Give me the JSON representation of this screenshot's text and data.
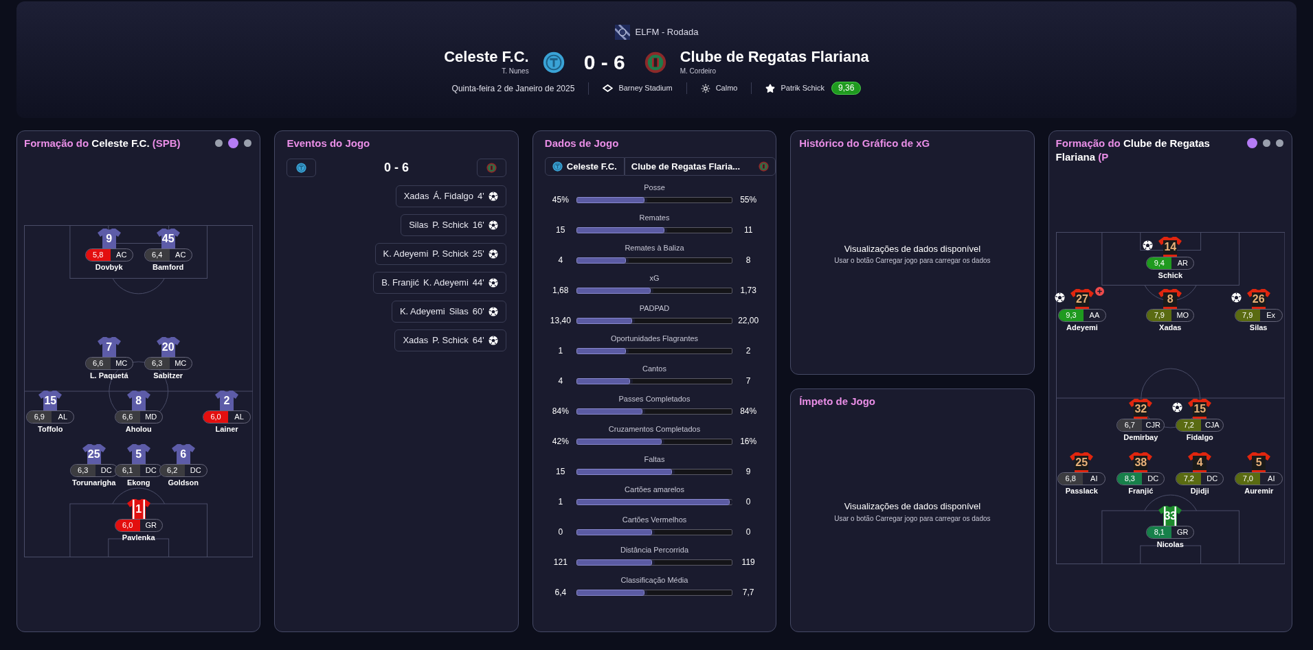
{
  "header": {
    "competition": "ELFM - Rodada",
    "home": {
      "name": "Celeste F.C.",
      "manager": "T. Nunes"
    },
    "score": "0 - 6",
    "away": {
      "name": "Clube de Regatas Flariana",
      "manager": "M. Cordeiro"
    },
    "date": "Quinta-feira 2 de Janeiro de 2025",
    "stadium": "Barney Stadium",
    "weather": "Calmo",
    "player_of_match": {
      "name": "Patrik Schick",
      "rating": "9,36",
      "color": "#1f9a1f"
    }
  },
  "home_lineup": {
    "title_prefix": "Formação do",
    "team": "Celeste F.C.",
    "suffix": "(SPB)",
    "dots": [
      {
        "selected": false
      },
      {
        "selected": true
      },
      {
        "selected": false
      }
    ],
    "rows": [
      {
        "kind": "compact",
        "players": [
          {
            "number": "9",
            "rating": "5,8",
            "color": "#e30f0f",
            "position": "AC",
            "name": "Dovbyk",
            "kind": "purple",
            "goal": false,
            "plus": false
          },
          {
            "number": "45",
            "rating": "6,4",
            "color": "#3c3c40",
            "position": "AC",
            "name": "Bamford",
            "kind": "purple",
            "goal": false,
            "plus": false
          }
        ]
      },
      {
        "kind": "compact",
        "players": [
          {
            "number": "7",
            "rating": "6,6",
            "color": "#3c3c40",
            "position": "MC",
            "name": "L. Paquetá",
            "kind": "purple",
            "goal": false,
            "plus": false
          },
          {
            "number": "20",
            "rating": "6,3",
            "color": "#3c3c40",
            "position": "MC",
            "name": "Sabitzer",
            "kind": "purple",
            "goal": false,
            "plus": false
          }
        ]
      },
      {
        "kind": "wide",
        "players": [
          {
            "number": "15",
            "rating": "6,9",
            "color": "#3c3c40",
            "position": "AL",
            "name": "Toffolo",
            "kind": "purple",
            "goal": false,
            "plus": false
          },
          {
            "number": "8",
            "rating": "6,6",
            "color": "#3c3c40",
            "position": "MD",
            "name": "Aholou",
            "kind": "purple",
            "goal": false,
            "plus": false
          },
          {
            "number": "2",
            "rating": "6,0",
            "color": "#e30f0f",
            "position": "AL",
            "name": "Lainer",
            "kind": "purple",
            "goal": false,
            "plus": false
          }
        ]
      },
      {
        "kind": "compact",
        "players": [
          {
            "number": "25",
            "rating": "6,3",
            "color": "#3c3c40",
            "position": "DC",
            "name": "Torunarigha",
            "kind": "purple",
            "goal": false,
            "plus": false
          },
          {
            "number": "5",
            "rating": "6,1",
            "color": "#3c3c40",
            "position": "DC",
            "name": "Ekong",
            "kind": "purple",
            "goal": false,
            "plus": false
          },
          {
            "number": "6",
            "rating": "6,2",
            "color": "#3c3c40",
            "position": "DC",
            "name": "Goldson",
            "kind": "purple",
            "goal": false,
            "plus": false
          }
        ]
      },
      {
        "kind": "compact",
        "players": [
          {
            "number": "1",
            "rating": "6,0",
            "color": "#e30f0f",
            "position": "GR",
            "name": "Pavlenka",
            "kind": "red-white",
            "goal": false,
            "plus": false
          }
        ]
      }
    ]
  },
  "events": {
    "title": "Eventos do Jogo",
    "score": "0 - 6",
    "items": [
      {
        "kind": "away",
        "assist": "Xadas",
        "scorer": "Á. Fidalgo",
        "minute": "4'"
      },
      {
        "kind": "away",
        "assist": "Silas",
        "scorer": "P. Schick",
        "minute": "16'"
      },
      {
        "kind": "away",
        "assist": "K. Adeyemi",
        "scorer": "P. Schick",
        "minute": "25'"
      },
      {
        "kind": "away",
        "assist": "B. Franjić",
        "scorer": "K. Adeyemi",
        "minute": "44'"
      },
      {
        "kind": "away",
        "assist": "K. Adeyemi",
        "scorer": "Silas",
        "minute": "60'"
      },
      {
        "kind": "away",
        "assist": "Xadas",
        "scorer": "P. Schick",
        "minute": "64'"
      }
    ]
  },
  "stats": {
    "title": "Dados de Jogo",
    "home_tab": "Celeste F.C.",
    "away_tab": "Clube de Regatas Flaria...",
    "rows": [
      {
        "label": "Posse",
        "home": "45%",
        "away": "55%",
        "level": 0.43
      },
      {
        "label": "Remates",
        "home": "15",
        "away": "11",
        "level": 0.56
      },
      {
        "label": "Remates à Baliza",
        "home": "4",
        "away": "8",
        "level": 0.31
      },
      {
        "label": "xG",
        "home": "1,68",
        "away": "1,73",
        "level": 0.47
      },
      {
        "label": "PADPAD",
        "home": "13,40",
        "away": "22,00",
        "level": 0.35
      },
      {
        "label": "Oportunidades Flagrantes",
        "home": "1",
        "away": "2",
        "level": 0.31
      },
      {
        "label": "Cantos",
        "home": "4",
        "away": "7",
        "level": 0.34
      },
      {
        "label": "Passes Completados",
        "home": "84%",
        "away": "84%",
        "level": 0.42
      },
      {
        "label": "Cruzamentos Completados",
        "home": "42%",
        "away": "16%",
        "level": 0.54
      },
      {
        "label": "Faltas",
        "home": "15",
        "away": "9",
        "level": 0.61
      },
      {
        "label": "Cartões amarelos",
        "home": "1",
        "away": "0",
        "level": 0.98
      },
      {
        "label": "Cartões Vermelhos",
        "home": "0",
        "away": "0",
        "level": 0.48
      },
      {
        "label": "Distância Percorrida",
        "home": "121",
        "away": "119",
        "level": 0.48
      },
      {
        "label": "Classificação Média",
        "home": "6,4",
        "away": "7,7",
        "level": 0.43
      }
    ]
  },
  "xg_history": {
    "title": "Histórico do Gráfico de xG",
    "message": "Visualizações de dados disponível",
    "hint": "Usar o botão Carregar jogo para carregar os dados"
  },
  "momentum": {
    "title": "Ímpeto de Jogo",
    "message": "Visualizações de dados disponível",
    "hint": "Usar o botão Carregar jogo para carregar os dados"
  },
  "away_lineup": {
    "title_prefix": "Formação do",
    "team": "Clube de Regatas Flariana",
    "suffix": "(P",
    "dots": [
      {
        "selected": true
      },
      {
        "selected": false
      },
      {
        "selected": false
      }
    ],
    "rows": [
      {
        "kind": "compact",
        "players": [
          {
            "number": "14",
            "rating": "9,4",
            "color": "#1f9a1f",
            "position": "AR",
            "name": "Schick",
            "kind": "red-black",
            "goal": true,
            "plus": false
          }
        ]
      },
      {
        "kind": "wide",
        "players": [
          {
            "number": "27",
            "rating": "9,3",
            "color": "#1f9a1f",
            "position": "AA",
            "name": "Adeyemi",
            "kind": "red-black",
            "goal": true,
            "plus": true
          },
          {
            "number": "8",
            "rating": "7,9",
            "color": "#5a6b12",
            "position": "MO",
            "name": "Xadas",
            "kind": "red-black",
            "goal": false,
            "plus": false
          },
          {
            "number": "26",
            "rating": "7,9",
            "color": "#5a6b12",
            "position": "Ex",
            "name": "Silas",
            "kind": "red-black",
            "goal": true,
            "plus": false
          }
        ]
      },
      {
        "kind": "compact",
        "players": [
          {
            "number": "32",
            "rating": "6,7",
            "color": "#3c3c40",
            "position": "CJR",
            "name": "Demirbay",
            "kind": "red-black",
            "goal": false,
            "plus": false
          },
          {
            "number": "15",
            "rating": "7,2",
            "color": "#5a6b12",
            "position": "CJA",
            "name": "Fidalgo",
            "kind": "red-black",
            "goal": true,
            "plus": false
          }
        ]
      },
      {
        "kind": "compact",
        "players": [
          {
            "number": "25",
            "rating": "6,8",
            "color": "#3c3c40",
            "position": "AI",
            "name": "Passlack",
            "kind": "red-black",
            "goal": false,
            "plus": false
          },
          {
            "number": "38",
            "rating": "8,3",
            "color": "#17804a",
            "position": "DC",
            "name": "Franjić",
            "kind": "red-black",
            "goal": false,
            "plus": false
          },
          {
            "number": "4",
            "rating": "7,2",
            "color": "#5a6b12",
            "position": "DC",
            "name": "Djidji",
            "kind": "red-black",
            "goal": false,
            "plus": false
          },
          {
            "number": "5",
            "rating": "7,0",
            "color": "#5a6b12",
            "position": "AI",
            "name": "Auremir",
            "kind": "red-black",
            "goal": false,
            "plus": false
          }
        ]
      },
      {
        "kind": "compact",
        "players": [
          {
            "number": "33",
            "rating": "8,1",
            "color": "#17804a",
            "position": "GR",
            "name": "Nicolas",
            "kind": "green-white",
            "goal": false,
            "plus": false
          }
        ]
      }
    ]
  }
}
